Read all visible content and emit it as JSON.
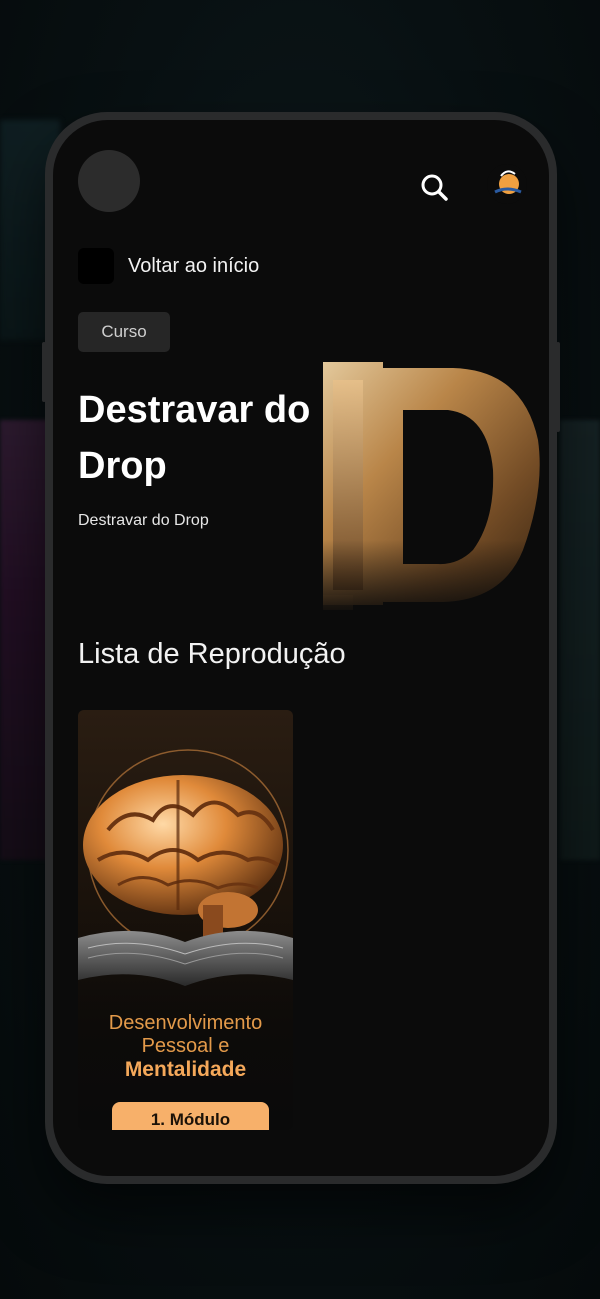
{
  "header": {
    "back_label": "Voltar ao início"
  },
  "course": {
    "badge": "Curso",
    "title": "Destravar do Drop",
    "subtitle": "Destravar do Drop"
  },
  "playlist": {
    "section_title": "Lista de Reprodução",
    "items": [
      {
        "title_line1": "Desenvolvimento",
        "title_line2": "Pessoal e",
        "title_line3": "Mentalidade",
        "button_label": "1. Módulo"
      }
    ]
  },
  "icons": [
    "search-icon",
    "avatar",
    "brain-illustration",
    "open-book-illustration"
  ],
  "colors": {
    "background": "#0b0b0b",
    "accent": "#f7b06a",
    "card_text": "#e39a4a"
  }
}
